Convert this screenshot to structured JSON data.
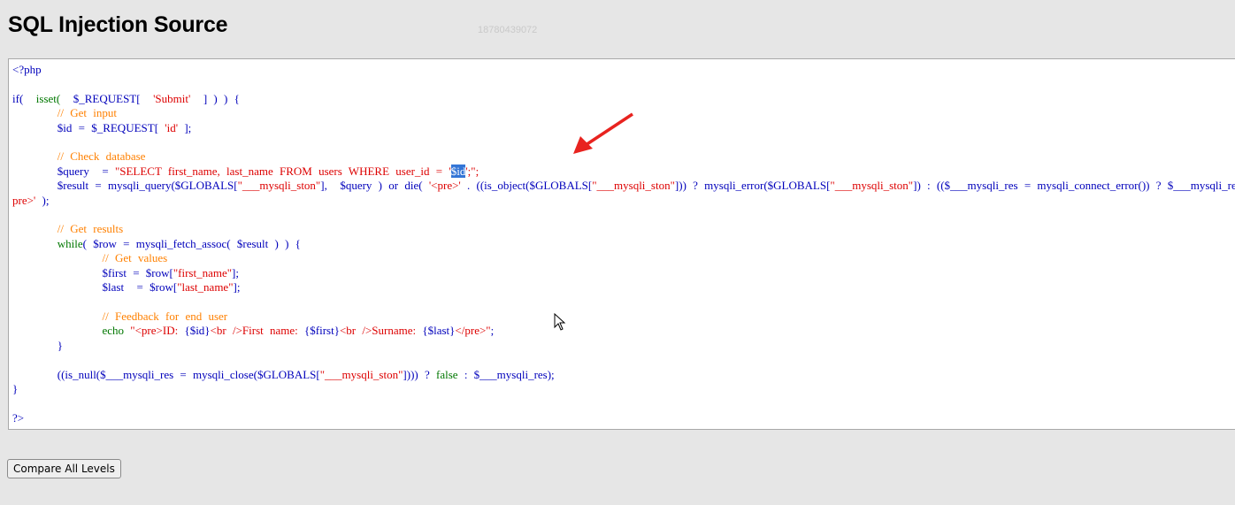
{
  "page": {
    "title": "SQL Injection Source",
    "watermark": "18780439072"
  },
  "code": {
    "lines": [
      [
        [
          "d",
          "<?php"
        ]
      ],
      [],
      [
        [
          "d",
          "if( "
        ],
        [
          "k",
          " isset( "
        ],
        [
          "d",
          " $_REQUEST[ "
        ],
        [
          "s",
          " 'Submit' "
        ],
        [
          "d",
          " ] ) ) {"
        ]
      ],
      [
        [
          "d",
          "       "
        ],
        [
          "c",
          "// Get input"
        ]
      ],
      [
        [
          "d",
          "       $id = $_REQUEST[ "
        ],
        [
          "s",
          "'id'"
        ],
        [
          "d",
          " ];"
        ]
      ],
      [],
      [
        [
          "d",
          "       "
        ],
        [
          "c",
          "// Check database"
        ]
      ],
      [
        [
          "d",
          "       $query  = "
        ],
        [
          "s",
          "\"SELECT first_name, last_name FROM users WHERE user_id = '"
        ],
        [
          "sel",
          "$id"
        ],
        [
          "s",
          "';\";"
        ]
      ],
      [
        [
          "d",
          "       $result = mysqli_query($GLOBALS["
        ],
        [
          "s",
          "\"___mysqli_ston\""
        ],
        [
          "d",
          "],  $query ) or die( "
        ],
        [
          "s",
          "'<pre>'"
        ],
        [
          "d",
          " . ((is_object($GLOBALS["
        ],
        [
          "s",
          "\"___mysqli_ston\""
        ],
        [
          "d",
          "])) ? mysqli_error($GLOBALS["
        ],
        [
          "s",
          "\"___mysqli_ston\""
        ],
        [
          "d",
          "]) : (($___mysqli_res = mysqli_connect_error()) ? $___mysqli_res : false)) . "
        ],
        [
          "s",
          "'</"
        ]
      ],
      [
        [
          "s",
          "pre>'"
        ],
        [
          "d",
          " );"
        ]
      ],
      [],
      [
        [
          "d",
          "       "
        ],
        [
          "c",
          "// Get results"
        ]
      ],
      [
        [
          "d",
          "       "
        ],
        [
          "k",
          "while"
        ],
        [
          "d",
          "( $row = mysqli_fetch_assoc( $result ) ) {"
        ]
      ],
      [
        [
          "d",
          "              "
        ],
        [
          "c",
          "// Get values"
        ]
      ],
      [
        [
          "d",
          "              $first = $row["
        ],
        [
          "s",
          "\"first_name\""
        ],
        [
          "d",
          "];"
        ]
      ],
      [
        [
          "d",
          "              $last  = $row["
        ],
        [
          "s",
          "\"last_name\""
        ],
        [
          "d",
          "];"
        ]
      ],
      [],
      [
        [
          "d",
          "              "
        ],
        [
          "c",
          "// Feedback for end user"
        ]
      ],
      [
        [
          "d",
          "              "
        ],
        [
          "k",
          "echo"
        ],
        [
          "s",
          " \"<pre>ID: "
        ],
        [
          "d",
          "{$id}"
        ],
        [
          "s",
          "<br />First name: "
        ],
        [
          "d",
          "{$first}"
        ],
        [
          "s",
          "<br />Surname: "
        ],
        [
          "d",
          "{$last}"
        ],
        [
          "s",
          "</pre>\""
        ],
        [
          "d",
          ";"
        ]
      ],
      [
        [
          "d",
          "       }"
        ]
      ],
      [],
      [
        [
          "d",
          "       ((is_null($___mysqli_res = mysqli_close($GLOBALS["
        ],
        [
          "s",
          "\"___mysqli_ston\""
        ],
        [
          "d",
          "]))) ? "
        ],
        [
          "k",
          "false"
        ],
        [
          "d",
          " : $___mysqli_res);"
        ]
      ],
      [
        [
          "d",
          "}"
        ]
      ],
      [],
      [
        [
          "d",
          "?>"
        ]
      ]
    ]
  },
  "buttons": {
    "compare_label": "Compare All Levels"
  },
  "colors": {
    "default": "#0000bb",
    "keyword": "#007700",
    "string": "#dd0000",
    "comment": "#ff8000",
    "selection": "#3375d6",
    "arrow": "#e8231f"
  },
  "icons": {
    "annotation": "red-arrow-icon",
    "pointer": "mouse-cursor-icon"
  }
}
